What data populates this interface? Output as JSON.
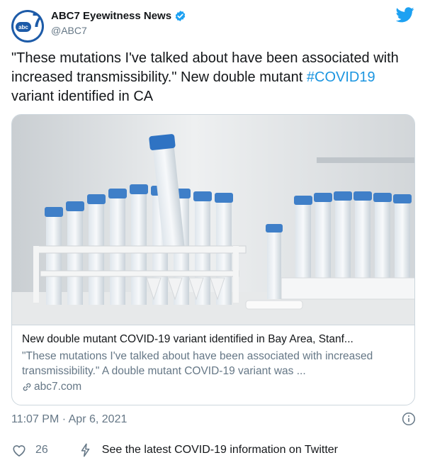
{
  "account": {
    "display_name": "ABC7 Eyewitness News",
    "handle": "@ABC7",
    "verified": true,
    "avatar": {
      "icon": "abc7-logo",
      "text": "abc",
      "number": "7",
      "color": "#1d5ba8"
    }
  },
  "tweet": {
    "text_before": "\"These mutations I've talked about have been associated with increased transmissibility.\" New double mutant ",
    "hashtag": "#COVID19",
    "text_after": " variant identified in CA",
    "timestamp": "11:07 PM · Apr 6, 2021"
  },
  "card": {
    "image_icon": "lab-test-tubes-photo",
    "title": "New double mutant COVID-19 variant identified in Bay Area, Stanf...",
    "description": "\"These mutations I've talked about have been associated with increased transmissibility.\" A double mutant COVID-19 variant was ...",
    "domain": "abc7.com"
  },
  "actions": {
    "like_count": "26",
    "covid_info": "See the latest COVID-19 information on Twitter"
  },
  "colors": {
    "link": "#1b95e0",
    "secondary_text": "#657786",
    "brand": "#1da1f2"
  }
}
